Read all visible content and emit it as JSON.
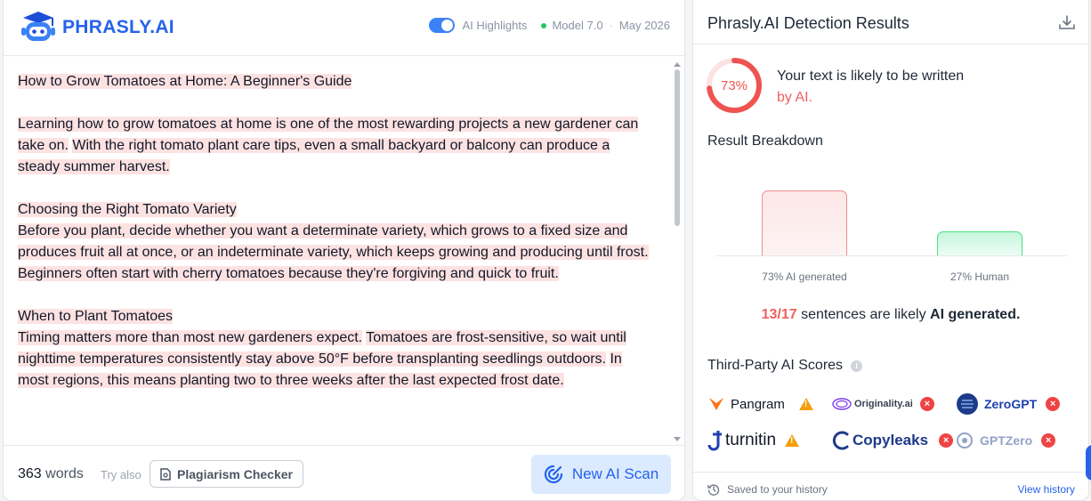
{
  "app": {
    "brand": "PHRASLY.AI",
    "top": {
      "toggle_label": "AI Highlights",
      "model": "Model 7.0",
      "date": "May 2026"
    }
  },
  "editor": {
    "title": "How to Grow Tomatoes at Home: A Beginner's Guide",
    "p1": [
      "Learning how to grow tomatoes at home is one of the most rewarding projects a new gardener can take on.",
      "With the right tomato plant care tips, even a small backyard or balcony can produce a steady summer harvest."
    ],
    "h2": "Choosing the Right Tomato Variety",
    "p2": [
      "Before you plant, decide whether you want a determinate variety, which grows to a fixed size and produces fruit all at once, or an indeterminate variety, which keeps growing and producing until frost.",
      "Beginners often start with cherry tomatoes because they're forgiving and quick to fruit."
    ],
    "h3": "When to Plant Tomatoes",
    "p3": [
      "Timing matters more than most new gardeners expect.",
      "Tomatoes are frost-sensitive, so wait until nighttime temperatures consistently stay above 50°F before transplanting seedlings outdoors.",
      "In most regions, this means planting two to three weeks after the last expected frost date."
    ]
  },
  "bottom": {
    "word_count": "363",
    "words_label": "words",
    "try_also": "Try also",
    "plagiarism_button": "Plagiarism Checker",
    "scan_button": "New AI Scan"
  },
  "results": {
    "title": "Phrasly.AI Detection Results",
    "score_label": "73%",
    "score_value": 73,
    "verdict_line1": "Your text is likely to be written",
    "verdict_line2": "by AI.",
    "breakdown_title": "Result Breakdown",
    "ai_label": "73% AI generated",
    "human_label": "27% Human",
    "ai_value": 73,
    "human_value": 27,
    "sentences_count": "13/17",
    "sentences_text": " sentences are likely ",
    "sentences_strong": "AI generated.",
    "third_party_title": "Third-Party AI Scores",
    "scores": {
      "pangram": "Pangram",
      "originality": "Originality.ai",
      "zerogpt": "ZeroGPT",
      "turnitin": "turnitin",
      "copyleaks": "Copyleaks",
      "gptzero": "GPTZero"
    },
    "saved_text": "Saved to your history",
    "view_history": "View history"
  },
  "colors": {
    "brand": "#2563eb",
    "ai_red": "#ef5350",
    "human_green": "#4ade80",
    "highlight": "#fde2e2"
  }
}
